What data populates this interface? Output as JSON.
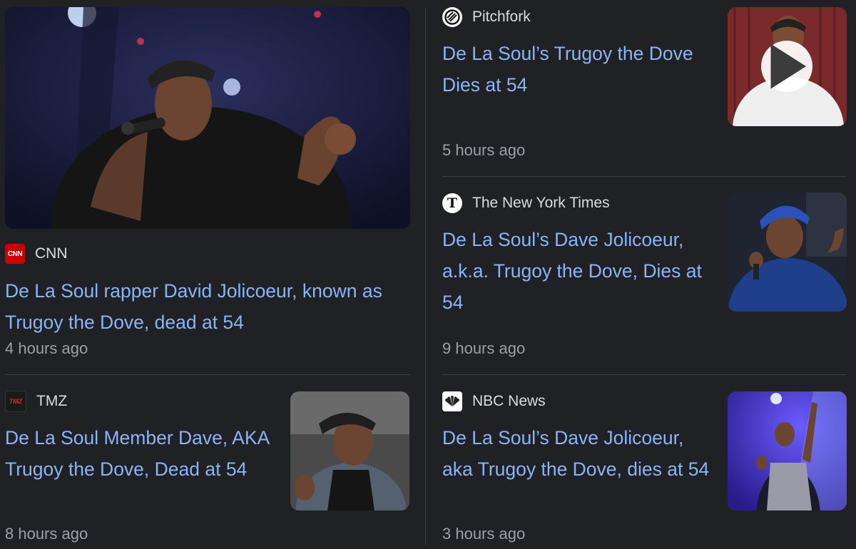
{
  "cards": [
    {
      "source": "CNN",
      "logo_text": "CNN",
      "headline": "De La Soul rapper David Jolicoeur, known as Trugoy the Dove, dead at 54",
      "time": "4 hours ago"
    },
    {
      "source": "Pitchfork",
      "headline": "De La Soul’s Trugoy the Dove Dies at 54",
      "time": "5 hours ago",
      "has_video": true
    },
    {
      "source": "The New York Times",
      "logo_text": "T",
      "headline": "De La Soul’s Dave Jolicoeur, a.k.a. Trugoy the Dove, Dies at 54",
      "time": "9 hours ago"
    },
    {
      "source": "TMZ",
      "logo_text": "TMZ",
      "headline": "De La Soul Member Dave, AKA Trugoy the Dove, Dead at 54",
      "time": "8 hours ago"
    },
    {
      "source": "NBC News",
      "headline": "De La Soul’s Dave Jolicoeur, aka Trugoy the Dove, dies at 54",
      "time": "3 hours ago"
    }
  ],
  "colors": {
    "background": "#202124",
    "headline_link": "#8ab4f8",
    "source_text": "#dadce0",
    "timestamp": "#9aa0a6",
    "divider": "#3c4043",
    "cnn_red": "#cc0000"
  }
}
